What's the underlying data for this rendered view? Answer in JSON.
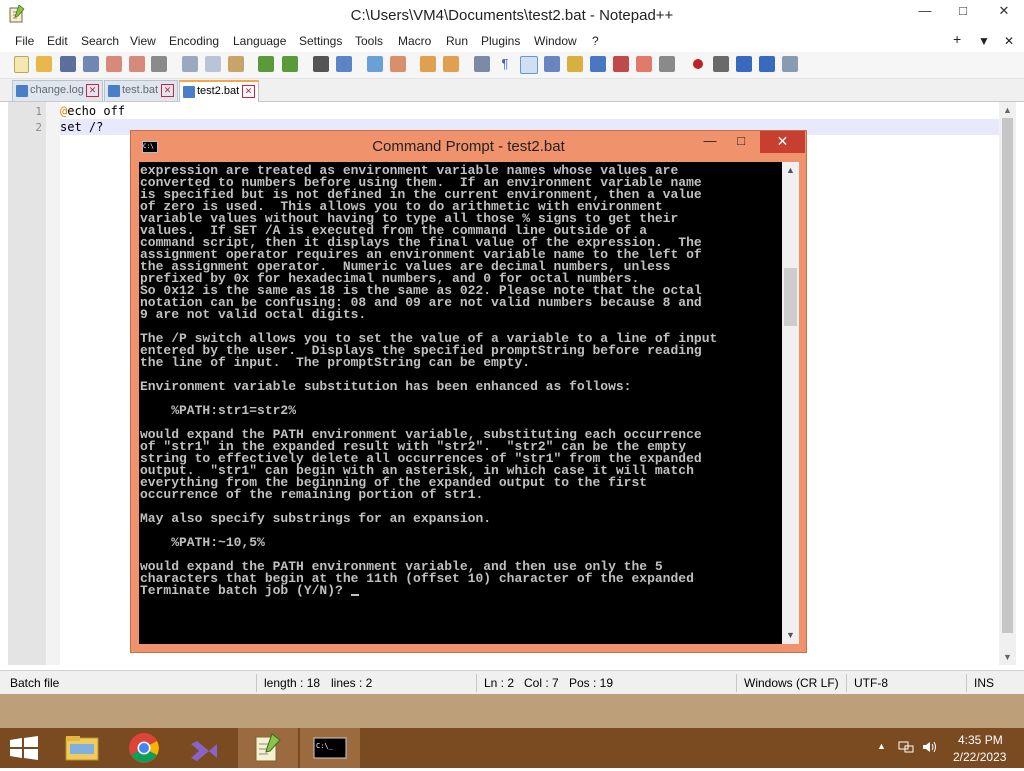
{
  "npp": {
    "title": "C:\\Users\\VM4\\Documents\\test2.bat - Notepad++",
    "menu": [
      "File",
      "Edit",
      "Search",
      "View",
      "Encoding",
      "Language",
      "Settings",
      "Tools",
      "Macro",
      "Run",
      "Plugins",
      "Window",
      "?"
    ],
    "menu_right": [
      "+",
      "▼",
      "✕"
    ],
    "tabs": [
      {
        "label": "change.log",
        "active": false
      },
      {
        "label": "test.bat",
        "active": false
      },
      {
        "label": "test2.bat",
        "active": true
      }
    ],
    "editor": {
      "lines": [
        {
          "num": "1",
          "text": "@echo off"
        },
        {
          "num": "2",
          "text": "set /?"
        }
      ]
    },
    "status": {
      "file_type": "Batch file",
      "length": "length : 18",
      "lines": "lines : 2",
      "ln": "Ln : 2",
      "col": "Col : 7",
      "pos": "Pos : 19",
      "eol": "Windows (CR LF)",
      "encoding": "UTF-8",
      "mode": "INS"
    },
    "colors": {
      "active_tab_accent": "#f5a64a",
      "gutter": "#e4e4e4"
    }
  },
  "cmd": {
    "title": "Command Prompt - test2.bat",
    "console_lines": [
      "expression are treated as environment variable names whose values are",
      "converted to numbers before using them.  If an environment variable name",
      "is specified but is not defined in the current environment, then a value",
      "of zero is used.  This allows you to do arithmetic with environment",
      "variable values without having to type all those % signs to get their",
      "values.  If SET /A is executed from the command line outside of a",
      "command script, then it displays the final value of the expression.  The",
      "assignment operator requires an environment variable name to the left of",
      "the assignment operator.  Numeric values are decimal numbers, unless",
      "prefixed by 0x for hexadecimal numbers, and 0 for octal numbers.",
      "So 0x12 is the same as 18 is the same as 022. Please note that the octal",
      "notation can be confusing: 08 and 09 are not valid numbers because 8 and",
      "9 are not valid octal digits.",
      "",
      "The /P switch allows you to set the value of a variable to a line of input",
      "entered by the user.  Displays the specified promptString before reading",
      "the line of input.  The promptString can be empty.",
      "",
      "Environment variable substitution has been enhanced as follows:",
      "",
      "    %PATH:str1=str2%",
      "",
      "would expand the PATH environment variable, substituting each occurrence",
      "of \"str1\" in the expanded result with \"str2\".  \"str2\" can be the empty",
      "string to effectively delete all occurrences of \"str1\" from the expanded",
      "output.  \"str1\" can begin with an asterisk, in which case it will match",
      "everything from the beginning of the expanded output to the first",
      "occurrence of the remaining portion of str1.",
      "",
      "May also specify substrings for an expansion.",
      "",
      "    %PATH:~10,5%",
      "",
      "would expand the PATH environment variable, and then use only the 5",
      "characters that begin at the 11th (offset 10) character of the expanded",
      "Terminate batch job (Y/N)? "
    ],
    "colors": {
      "frame": "#f0926b",
      "close": "#c7402f",
      "console_bg": "#000000",
      "console_fg": "#c0c0c0"
    }
  },
  "taskbar": {
    "apps": [
      "file-explorer",
      "chrome",
      "visual-studio",
      "notepad-plus-plus",
      "command-prompt"
    ],
    "time": "4:35 PM",
    "date": "2/22/2023",
    "color": "#7a4a21"
  }
}
